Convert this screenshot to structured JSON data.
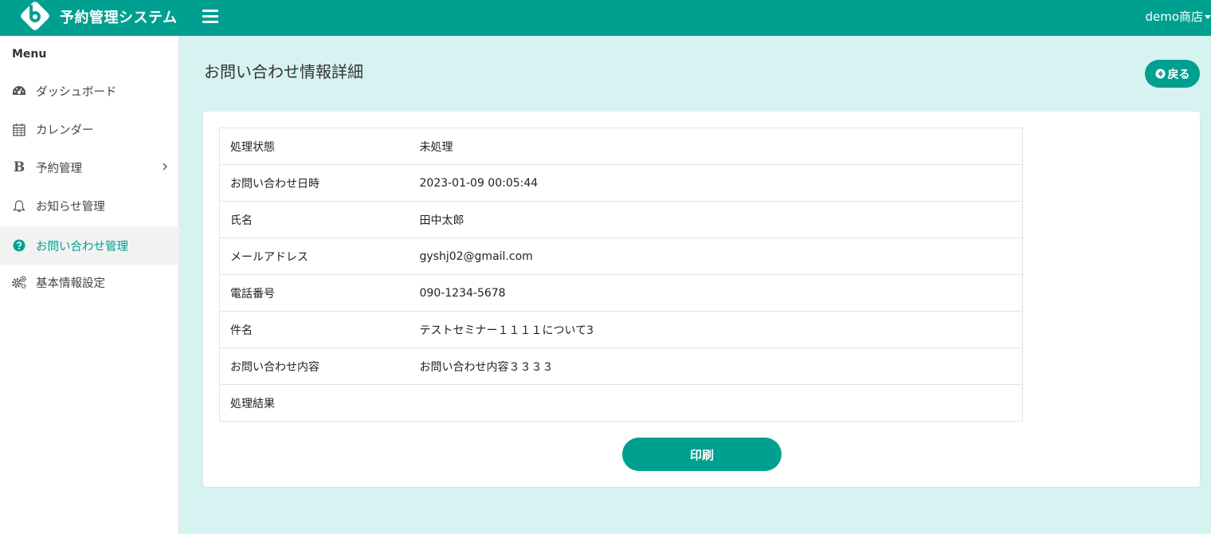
{
  "header": {
    "app_title": "予約管理システム",
    "store_name": "demo商店",
    "brand_color": "#00a091"
  },
  "sidebar": {
    "menu_title": "Menu",
    "items": [
      {
        "label": "ダッシュボード",
        "icon": "dashboard-icon"
      },
      {
        "label": "カレンダー",
        "icon": "calendar-icon"
      },
      {
        "label": "予約管理",
        "icon": "bold-b-icon",
        "has_submenu": true
      },
      {
        "label": "お知らせ管理",
        "icon": "bell-icon"
      },
      {
        "label": "お問い合わせ管理",
        "icon": "question-circle-icon",
        "active": true
      },
      {
        "label": "基本情報設定",
        "icon": "gears-icon"
      }
    ]
  },
  "main": {
    "page_title": "お問い合わせ情報詳細",
    "back_label": "戻る",
    "print_label": "印刷",
    "rows": [
      {
        "label": "処理状態",
        "value": "未処理"
      },
      {
        "label": "お問い合わせ日時",
        "value": "2023-01-09 00:05:44"
      },
      {
        "label": "氏名",
        "value": "田中太郎"
      },
      {
        "label": "メールアドレス",
        "value": "gyshj02@gmail.com"
      },
      {
        "label": "電話番号",
        "value": "090-1234-5678"
      },
      {
        "label": "件名",
        "value": "テストセミナー１１１１について3"
      },
      {
        "label": "お問い合わせ内容",
        "value": "お問い合わせ内容３３３３"
      },
      {
        "label": "処理結果",
        "value": ""
      }
    ],
    "status_color": "#d0103a"
  }
}
